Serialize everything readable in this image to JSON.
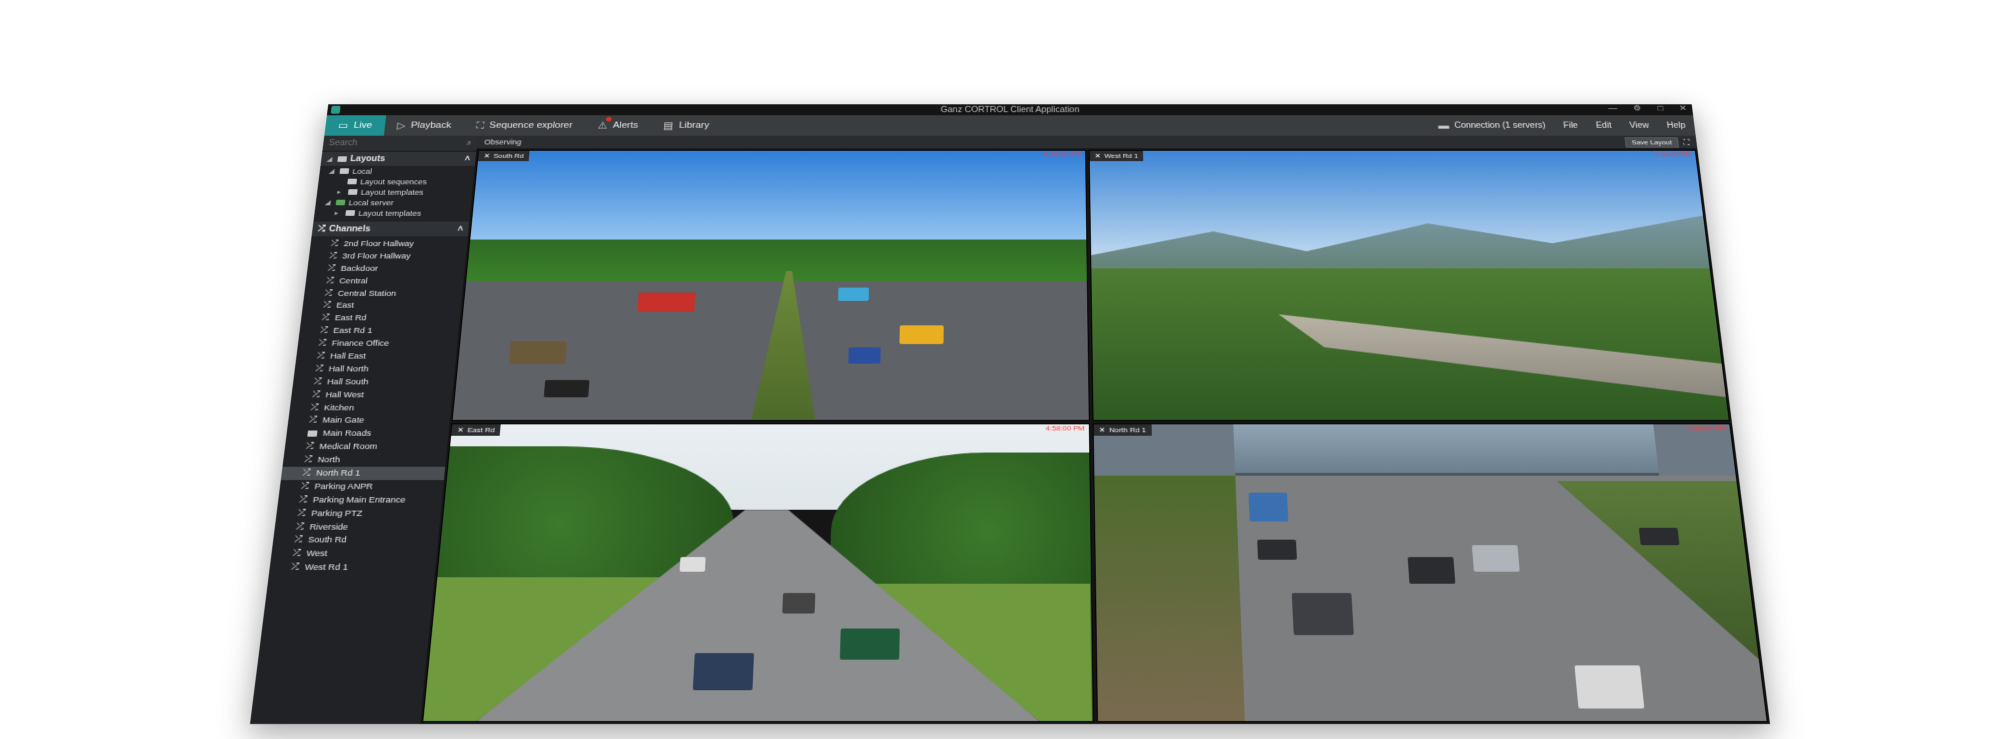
{
  "window": {
    "title": "Ganz CORTROL Client Application"
  },
  "toolbar": {
    "live": "Live",
    "playback": "Playback",
    "sequence_explorer": "Sequence explorer",
    "alerts": "Alerts",
    "library": "Library",
    "connection": "Connection (1 servers)",
    "file": "File",
    "edit": "Edit",
    "view": "View",
    "help": "Help"
  },
  "sidebar": {
    "search_placeholder": "Search",
    "layouts_heading": "Layouts",
    "layouts_items": [
      "Local",
      "Layout sequences",
      "Layout templates",
      "Local server",
      "Layout templates"
    ],
    "channels_heading": "Channels",
    "channels": [
      "2nd Floor Hallway",
      "3rd Floor Hallway",
      "Backdoor",
      "Central",
      "Central Station",
      "East",
      "East Rd",
      "East Rd 1",
      "Finance Office",
      "Hall East",
      "Hall North",
      "Hall South",
      "Hall West",
      "Kitchen",
      "Main Gate",
      "Main Roads",
      "Medical Room",
      "North",
      "North Rd 1",
      "Parking ANPR",
      "Parking Main Entrance",
      "Parking PTZ",
      "Riverside",
      "South Rd",
      "West",
      "West Rd 1"
    ],
    "selected_channel": "North Rd 1"
  },
  "content": {
    "layout_name": "Observing",
    "save_layout": "Save Layout"
  },
  "tiles": [
    {
      "label": "South Rd",
      "time": "4:58:00 PM"
    },
    {
      "label": "West Rd 1",
      "time": "4:58:00 PM"
    },
    {
      "label": "East Rd",
      "time": "4:58:00 PM"
    },
    {
      "label": "North Rd 1",
      "time": "4:58:00 PM"
    }
  ],
  "colors": {
    "accent": "#1f8f8f",
    "timestamp": "#ff3b3b",
    "alert": "#dd3322"
  }
}
